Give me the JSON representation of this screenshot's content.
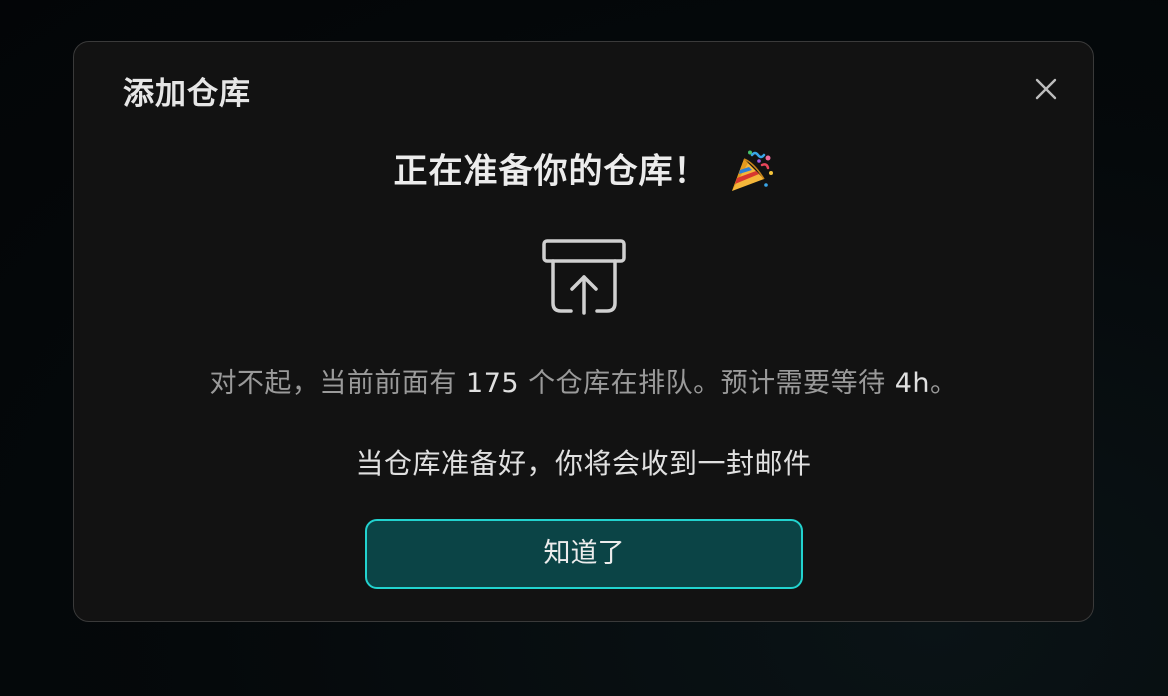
{
  "dialog": {
    "title": "添加仓库",
    "headline": "正在准备你的仓库！",
    "headline_emoji": "party-popper-icon",
    "queue_message": {
      "prefix": "对不起，当前前面有 ",
      "queue_count": "175",
      "middle": " 个仓库在排队。预计需要等待 ",
      "wait_time": "4h",
      "suffix": "。"
    },
    "email_message": "当仓库准备好，你将会收到一封邮件",
    "confirm_button": "知道了"
  },
  "colors": {
    "background": "#05090b",
    "panel": "#121212",
    "panel_border": "#3a3a3a",
    "accent_border": "#22d3cf",
    "button_fill": "#0b4446",
    "text_primary": "#e6e6e6",
    "text_muted": "#9a9a9a"
  }
}
